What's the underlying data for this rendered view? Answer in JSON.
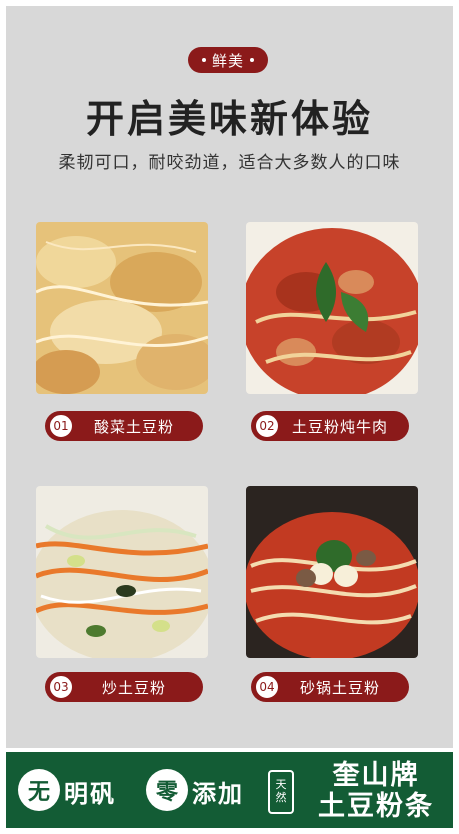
{
  "header": {
    "badge": "鲜美",
    "title": "开启美味新体验",
    "subtitle": "柔韧可口，耐咬劲道，适合大多数人的口味"
  },
  "dishes": [
    {
      "num": "01",
      "name": "酸菜土豆粉"
    },
    {
      "num": "02",
      "name": "土豆粉炖牛肉"
    },
    {
      "num": "03",
      "name": "炒土豆粉"
    },
    {
      "num": "04",
      "name": "砂锅土豆粉"
    }
  ],
  "footer": {
    "item1_icon": "无",
    "item1_text": "明矾",
    "item2_icon": "零",
    "item2_text": "添加",
    "seal_line1": "天",
    "seal_line2": "然",
    "brand_line1": "奎山牌",
    "brand_line2": "土豆粉条"
  },
  "colors": {
    "accent": "#8b1a1a",
    "footer_bg": "#135c35",
    "panel_bg": "#d8d8d8"
  }
}
